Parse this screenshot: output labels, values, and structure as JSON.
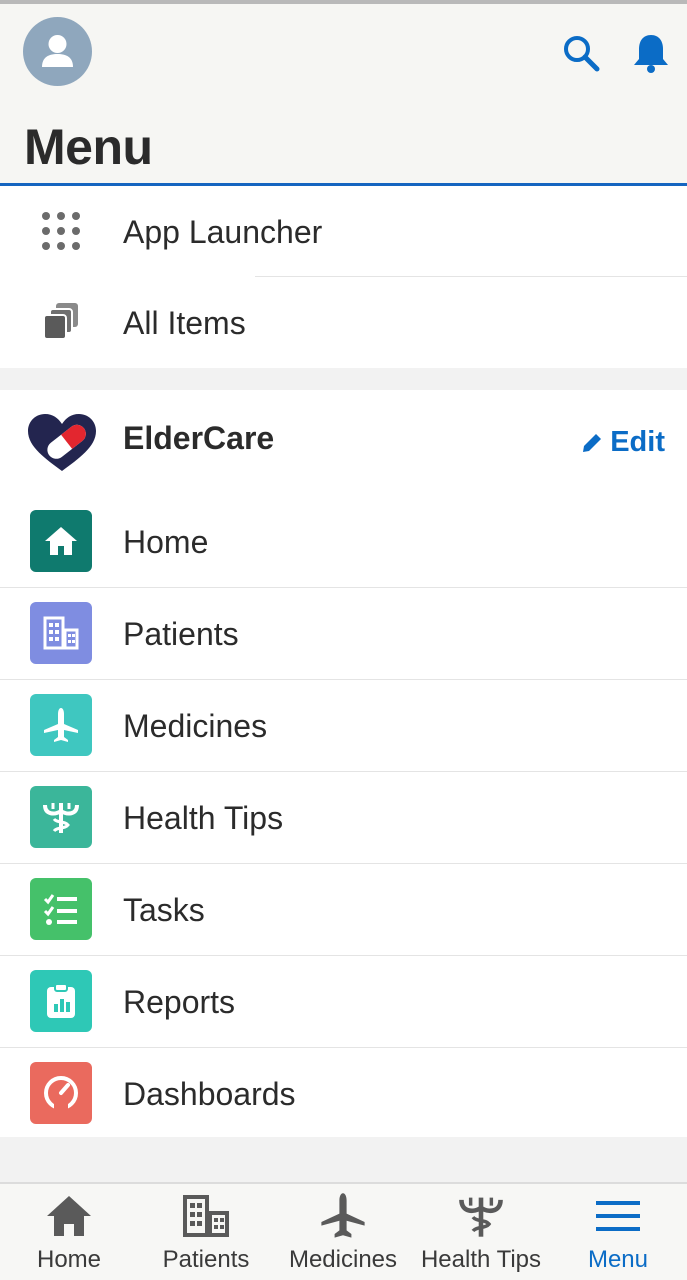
{
  "header": {
    "title": "Menu",
    "icons": {
      "avatar": "user-avatar",
      "search": "search-icon",
      "notifications": "bell-icon"
    }
  },
  "top_items": [
    {
      "label": "App Launcher",
      "icon": "grid-icon"
    },
    {
      "label": "All Items",
      "icon": "stack-icon"
    }
  ],
  "app": {
    "name": "ElderCare",
    "edit_label": "Edit",
    "logo": "pill-heart-logo"
  },
  "nav_items": [
    {
      "label": "Home",
      "icon": "home-icon",
      "color": "#0f7a6e"
    },
    {
      "label": "Patients",
      "icon": "building-icon",
      "color": "#7f8de1"
    },
    {
      "label": "Medicines",
      "icon": "plane-icon",
      "color": "#3fc7c0"
    },
    {
      "label": "Health Tips",
      "icon": "caduceus-icon",
      "color": "#3bb69a"
    },
    {
      "label": "Tasks",
      "icon": "checklist-icon",
      "color": "#45c16a"
    },
    {
      "label": "Reports",
      "icon": "report-icon",
      "color": "#2ec8b6"
    },
    {
      "label": "Dashboards",
      "icon": "gauge-icon",
      "color": "#ea6a5e"
    }
  ],
  "bottom_nav": [
    {
      "label": "Home",
      "icon": "home-icon",
      "active": false
    },
    {
      "label": "Patients",
      "icon": "building-icon",
      "active": false
    },
    {
      "label": "Medicines",
      "icon": "plane-icon",
      "active": false
    },
    {
      "label": "Health Tips",
      "icon": "caduceus-icon",
      "active": false
    },
    {
      "label": "Menu",
      "icon": "hamburger-icon",
      "active": true
    }
  ],
  "colors": {
    "accent": "#0b6cc6",
    "header_rule": "#1565c0"
  }
}
